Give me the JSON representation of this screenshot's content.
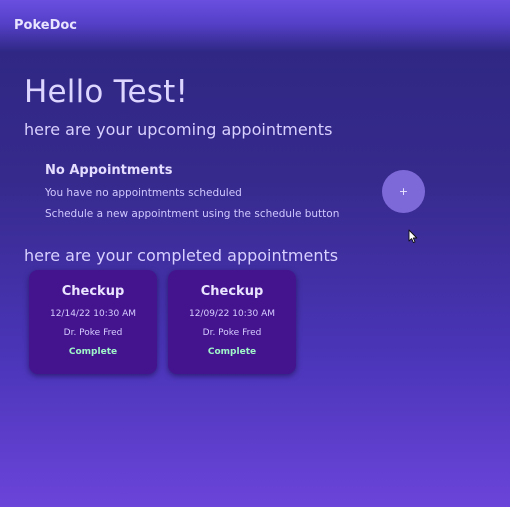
{
  "app": {
    "brand": "PokeDoc"
  },
  "greeting": "Hello Test!",
  "upcoming": {
    "heading": "here are your upcoming appointments",
    "empty_title": "No Appointments",
    "empty_line1": "You have no appointments scheduled",
    "empty_line2": "Schedule a new appointment using the schedule button",
    "add_button_label": "+",
    "add_button_icon": "plus-icon"
  },
  "completed": {
    "heading": "here are your completed appointments",
    "cards": [
      {
        "title": "Checkup",
        "datetime": "12/14/22 10:30 AM",
        "doctor": "Dr. Poke Fred",
        "status": "Complete"
      },
      {
        "title": "Checkup",
        "datetime": "12/09/22 10:30 AM",
        "doctor": "Dr. Poke Fred",
        "status": "Complete"
      }
    ]
  },
  "colors": {
    "background_top": "#2d2680",
    "background_bottom": "#6b44d9",
    "card_background": "#44148f",
    "status_color": "#9ff5c8",
    "add_button": "#7e69d8"
  }
}
